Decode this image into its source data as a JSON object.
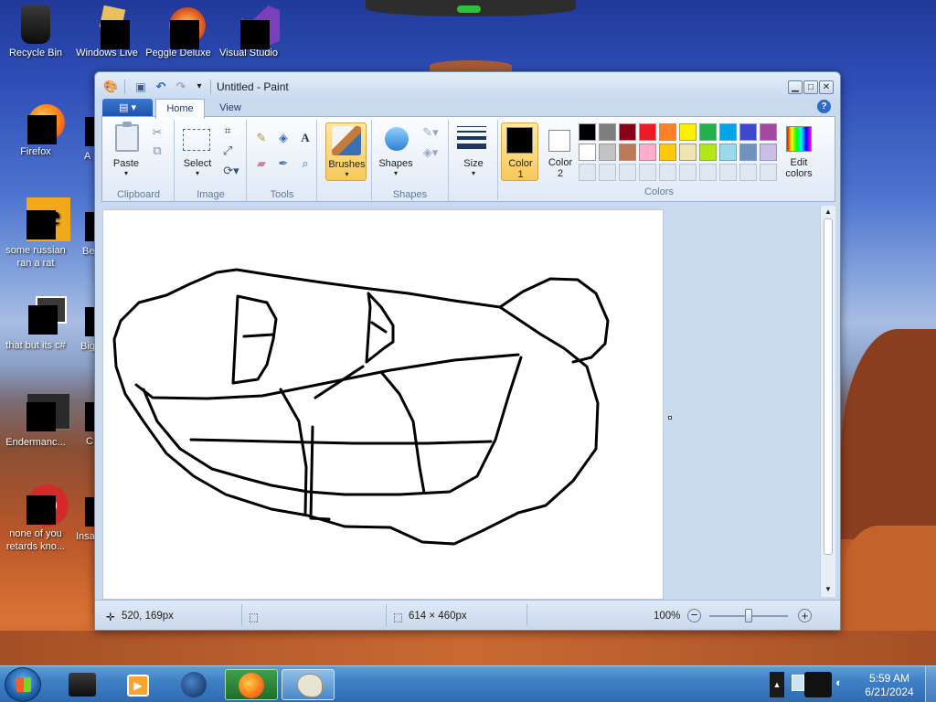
{
  "desktop": {
    "icons": [
      {
        "name": "recycle-bin",
        "label": "Recycle Bin"
      },
      {
        "name": "windows-live",
        "label": "Windows Live"
      },
      {
        "name": "peggle-deluxe",
        "label": "Peggle Deluxe"
      },
      {
        "name": "visual-studio",
        "label": "Visual Studio"
      },
      {
        "name": "firefox",
        "label": "Firefox"
      },
      {
        "name": "some-russian",
        "label": "some russian ran a rat"
      },
      {
        "name": "that-but-csharp",
        "label": "that but its c#"
      },
      {
        "name": "endermanch",
        "label": "Endermanc..."
      },
      {
        "name": "none-of-you",
        "label": "none of you retards kno..."
      }
    ],
    "partial_labels": [
      "A",
      "Be",
      "Big",
      "C",
      "Insa"
    ]
  },
  "window": {
    "title": "Untitled - Paint",
    "tabs": [
      {
        "label": "Home"
      },
      {
        "label": "View"
      }
    ],
    "groups": {
      "clipboard": "Clipboard",
      "image": "Image",
      "tools": "Tools",
      "shapes": "Shapes",
      "colors": "Colors"
    },
    "buttons": {
      "paste": "Paste",
      "select": "Select",
      "brushes": "Brushes",
      "shapes": "Shapes",
      "size": "Size",
      "color1": "Color\n1",
      "color1_line1": "Color",
      "color1_line2": "1",
      "color2_line1": "Color",
      "color2_line2": "2",
      "edit_colors_line1": "Edit",
      "edit_colors_line2": "colors"
    },
    "palette_row1": [
      "#000000",
      "#7f7f7f",
      "#880015",
      "#ed1c24",
      "#ff7f27",
      "#fff200",
      "#22b14c",
      "#00a2e8",
      "#3f48cc",
      "#a349a4"
    ],
    "palette_row2": [
      "#ffffff",
      "#c3c3c3",
      "#b97a57",
      "#ffaec9",
      "#ffc90e",
      "#efe4b0",
      "#b5e61d",
      "#99d9ea",
      "#7092be",
      "#c8bfe7"
    ],
    "color1": "#000000",
    "color2": "#ffffff",
    "status": {
      "cursor": "520, 169px",
      "size": "614 × 460px",
      "zoom": "100%"
    }
  },
  "taskbar": {
    "time": "5:59 AM",
    "date": "6/21/2024"
  }
}
